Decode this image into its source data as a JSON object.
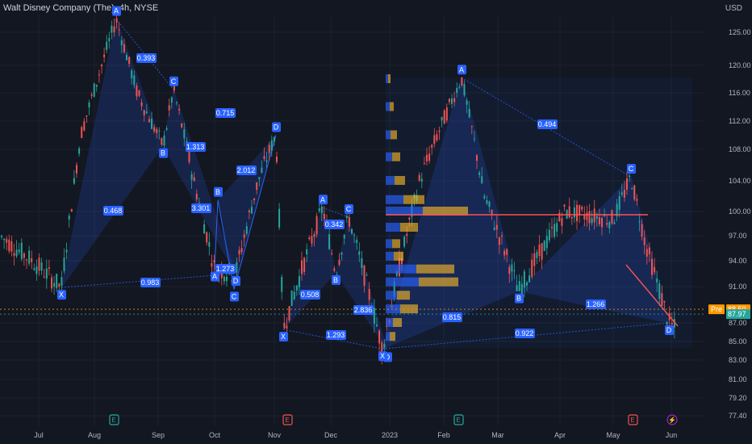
{
  "chart_data": {
    "type": "candlestick",
    "title": "Walt Disney Company (The), 4h, NYSE",
    "currency": "USD",
    "y_ticks": [
      "125.00",
      "120.00",
      "116.00",
      "112.00",
      "108.00",
      "104.00",
      "100.00",
      "97.00",
      "94.00",
      "91.00",
      "87.00",
      "85.00",
      "83.00",
      "81.00",
      "79.20",
      "77.40"
    ],
    "x_ticks": [
      "Jul",
      "Aug",
      "Sep",
      "Oct",
      "Nov",
      "Dec",
      "2023",
      "Feb",
      "Mar",
      "Apr",
      "May",
      "Jun"
    ],
    "price_badges": [
      {
        "label": "Pre",
        "value": "88.50",
        "color": "#ff9800"
      },
      {
        "value": "87.97",
        "color": "#26a69a"
      }
    ],
    "volume_profile_poc": 99.6,
    "patterns": [
      {
        "points": [
          {
            "label": "X",
            "x": "Jul",
            "price": 90.9
          },
          {
            "label": "A",
            "x": "Aug",
            "price": 127.0
          },
          {
            "label": "B",
            "x": "Sep",
            "price": 108.5
          },
          {
            "label": "C",
            "x": "Sep",
            "price": 116.5
          },
          {
            "label": "D",
            "x": "Oct",
            "price": 92.5
          }
        ],
        "ratios": [
          "0.393",
          "0.715",
          "0.468",
          "0.983",
          "1.273",
          "3.301"
        ]
      },
      {
        "points": [
          {
            "label": "A",
            "x": "Oct",
            "price": 93.0
          },
          {
            "label": "B",
            "x": "Oct",
            "price": 101.5
          },
          {
            "label": "C",
            "x": "Oct",
            "price": 90.7
          },
          {
            "label": "D",
            "x": "Nov",
            "price": 110.0
          }
        ],
        "ratios": [
          "1.313",
          "2.012"
        ]
      },
      {
        "points": [
          {
            "label": "X",
            "x": "Nov",
            "price": 86.3
          },
          {
            "label": "A",
            "x": "Nov",
            "price": 100.5
          },
          {
            "label": "B",
            "x": "Dec",
            "price": 92.6
          },
          {
            "label": "C",
            "x": "Dec",
            "price": 99.3
          },
          {
            "label": "D",
            "x": "Dec",
            "price": 84.1
          }
        ],
        "ratios": [
          "0.508",
          "0.342",
          "2.836",
          "1.293"
        ]
      },
      {
        "points": [
          {
            "label": "X",
            "x": "Dec",
            "price": 84.2
          },
          {
            "label": "A",
            "x": "Feb",
            "price": 118.2
          },
          {
            "label": "B",
            "x": "Mar",
            "price": 90.5
          },
          {
            "label": "C",
            "x": "May",
            "price": 104.5
          },
          {
            "label": "D",
            "x": "May",
            "price": 87.0
          }
        ],
        "ratios": [
          "0.494",
          "0.815",
          "1.266",
          "0.922"
        ]
      }
    ],
    "events": [
      {
        "type": "earnings",
        "label": "E",
        "x": "Aug",
        "color": "#26a69a"
      },
      {
        "type": "earnings",
        "label": "E",
        "x": "Nov",
        "color": "#ef5350"
      },
      {
        "type": "earnings",
        "label": "E",
        "x": "Feb",
        "color": "#26a69a"
      },
      {
        "type": "earnings",
        "label": "E",
        "x": "May",
        "color": "#ef5350"
      },
      {
        "type": "split",
        "label": "⚡",
        "x": "Jun",
        "color": "#9c27b0"
      }
    ],
    "colors": {
      "up": "#26a69a",
      "down": "#ef5350",
      "pattern": "#2962ff",
      "background": "#131722",
      "poc": "#ff5252",
      "vp_up": "#2962ff",
      "vp_down": "#f0b429"
    },
    "grid": true
  }
}
